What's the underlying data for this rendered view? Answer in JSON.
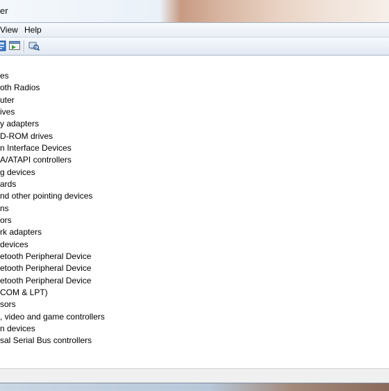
{
  "window": {
    "title": "er"
  },
  "menu": {
    "view": "View",
    "help": "Help"
  },
  "toolbar": {
    "buttons": [
      {
        "icon": "properties-icon"
      },
      {
        "icon": "update-driver-icon"
      },
      {
        "icon": "scan-hardware-icon"
      }
    ]
  },
  "tree": {
    "items": [
      {
        "label": "es"
      },
      {
        "label": "oth Radios"
      },
      {
        "label": "uter"
      },
      {
        "label": "ives"
      },
      {
        "label": "y adapters"
      },
      {
        "label": "D-ROM drives"
      },
      {
        "label": "n Interface Devices"
      },
      {
        "label": "A/ATAPI controllers"
      },
      {
        "label": "g devices"
      },
      {
        "label": "ards"
      },
      {
        "label": "nd other pointing devices"
      },
      {
        "label": "ns"
      },
      {
        "label": "ors"
      },
      {
        "label": "rk adapters"
      },
      {
        "label": "devices"
      },
      {
        "label": "etooth Peripheral Device"
      },
      {
        "label": "etooth Peripheral Device"
      },
      {
        "label": "etooth Peripheral Device"
      },
      {
        "label": "COM & LPT)"
      },
      {
        "label": "sors"
      },
      {
        "label": ", video and game controllers"
      },
      {
        "label": "n devices"
      },
      {
        "label": "sal Serial Bus controllers"
      }
    ]
  }
}
